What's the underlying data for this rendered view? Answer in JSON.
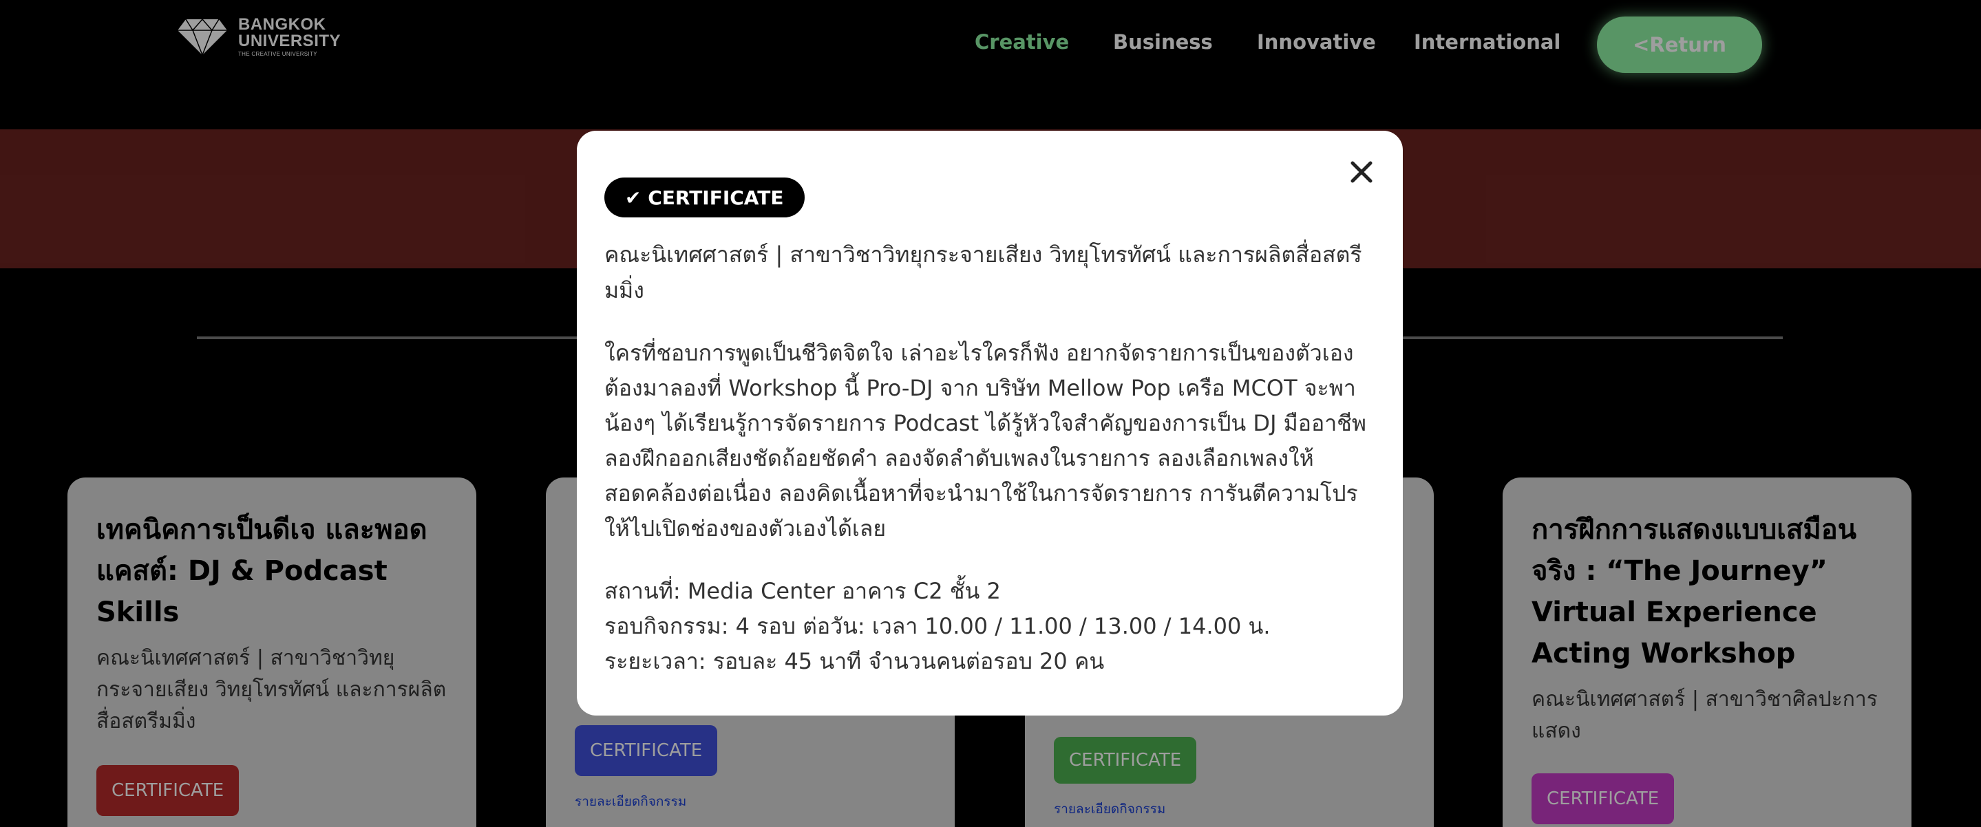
{
  "header": {
    "logo": {
      "line1": "BANGKOK",
      "line2": "UNIVERSITY",
      "tagline": "THE CREATIVE UNIVERSITY"
    },
    "nav": [
      "Creative",
      "Business",
      "Innovative",
      "International"
    ],
    "active_nav": "Creative",
    "return_label": "<Return",
    "accent_color": "#8ff0a4"
  },
  "cards": [
    {
      "title": "เทคนิคการเป็นดีเจ และพอดแคสต์: DJ & Podcast Skills",
      "faculty": "คณะนิเทศศาสตร์ | สาขาวิชาวิทยุกระจายเสียง วิทยุโทรทัศน์ และการผลิตสื่อสตรีมมิ่ง",
      "button": "CERTIFICATE",
      "button_color": "#b32a2a"
    },
    {
      "button": "CERTIFICATE",
      "button_color": "#3f4fd8",
      "link": "รายละเอียดกิจกรรม"
    },
    {
      "button": "CERTIFICATE",
      "button_color": "#4caf50",
      "link": "รายละเอียดกิจกรรม"
    },
    {
      "title": "การฝึกการแสดงแบบเสมือนจริง : “The Journey” Virtual Experience Acting Workshop",
      "faculty": "คณะนิเทศศาสตร์ | สาขาวิชาศิลปะการแสดง",
      "button": "CERTIFICATE",
      "button_color": "#c23bc4"
    }
  ],
  "modal": {
    "badge": "✔ CERTIFICATE",
    "faculty": "คณะนิเทศศาสตร์ | สาขาวิชาวิทยุกระจายเสียง วิทยุโทรทัศน์ และการผลิตสื่อสตรีมมิ่ง",
    "description": "ใครที่ชอบการพูดเป็นชีวิตจิตใจ เล่าอะไรใครก็ฟัง อยากจัดรายการเป็นของตัวเอง ต้องมาลองที่ Workshop นี้ Pro-DJ จาก บริษัท Mellow Pop เครือ MCOT จะพาน้องๆ ได้เรียนรู้การจัดรายการ Podcast ได้รู้หัวใจสำคัญของการเป็น DJ มืออาชีพ ลองฝึกออกเสียงชัดถ้อยชัดคำ ลองจัดลำดับเพลงในรายการ ลองเลือกเพลงให้สอดคล้องต่อเนื่อง ลองคิดเนื้อหาที่จะนำมาใช้ในการจัดรายการ การันตีความโปรให้ไปเปิดช่องของตัวเองได้เลย",
    "location": "สถานที่: Media Center อาคาร C2 ชั้น 2",
    "rounds": "รอบกิจกรรม: 4 รอบ ต่อวัน: เวลา 10.00 / 11.00 / 13.00 / 14.00 น.",
    "duration": "ระยะเวลา: รอบละ 45 นาที จำนวนคนต่อรอบ 20 คน"
  }
}
